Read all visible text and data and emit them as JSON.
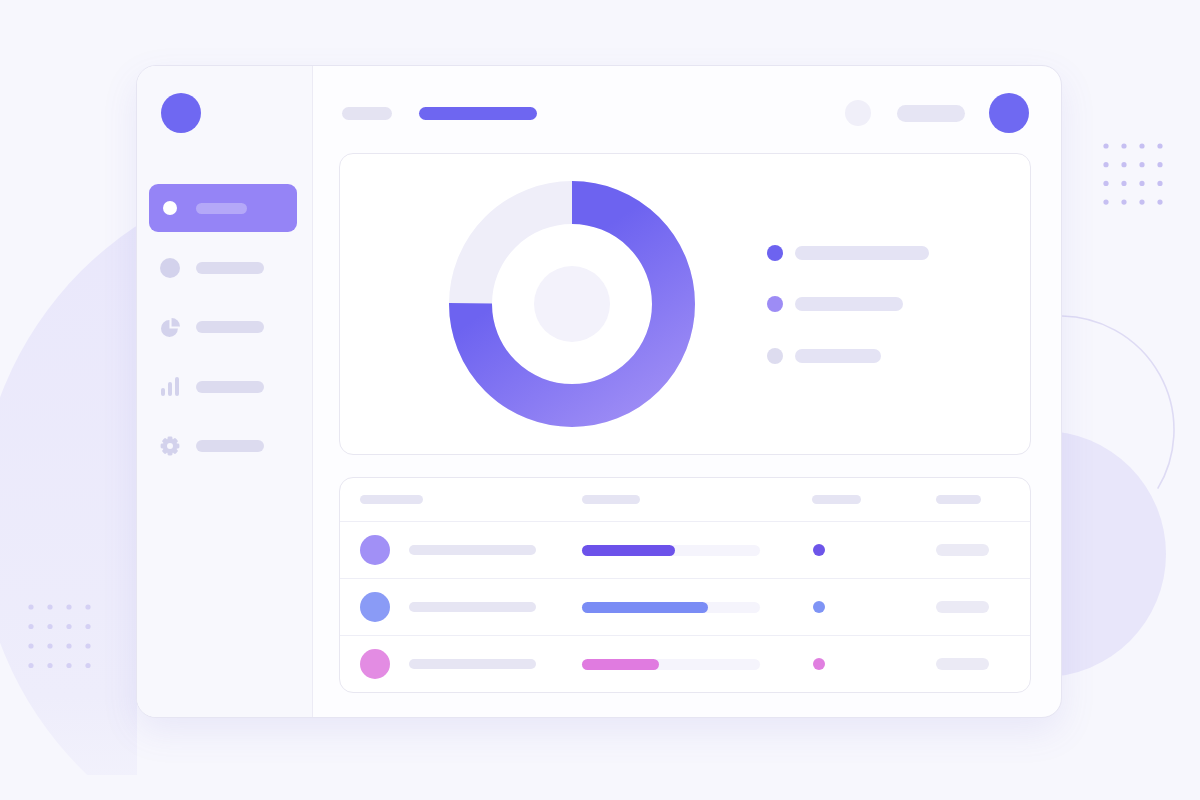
{
  "sidebar": {
    "items": [
      {
        "selected": true
      },
      {
        "selected": false
      },
      {
        "selected": false
      },
      {
        "selected": false
      },
      {
        "selected": false
      }
    ]
  },
  "header": {
    "tabs": [
      {
        "selected": false
      },
      {
        "selected": true
      }
    ]
  },
  "chart_card": {
    "legend": [
      {
        "color": "#6d63f0"
      },
      {
        "color": "#9d8cf5"
      },
      {
        "color": "#dddcef"
      }
    ]
  },
  "table": {
    "rows": [
      {
        "avatar": {
          "color": "#a190f6"
        },
        "progress": {
          "level": 0.52,
          "color": "#6c52ea"
        },
        "status": {
          "color": "#6d55e9"
        }
      },
      {
        "avatar": {
          "color": "#8a9bf6"
        },
        "progress": {
          "level": 0.71,
          "color": "#7a8cf5"
        },
        "status": {
          "color": "#7f94f5"
        }
      },
      {
        "avatar": {
          "color": "#e38ce3"
        },
        "progress": {
          "level": 0.43,
          "color": "#e07be0"
        },
        "status": {
          "color": "#e07fe0"
        }
      }
    ]
  }
}
